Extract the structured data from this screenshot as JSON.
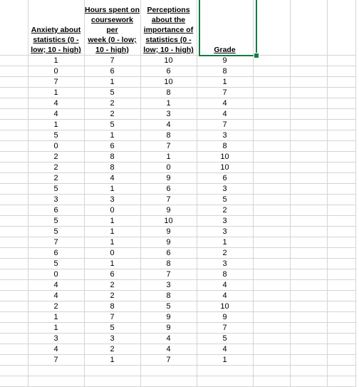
{
  "sheet": {
    "headers": [
      "Anxiety about statistics (0 - low; 10 - high)",
      "Hours spent on coursework per week (0 - low; 10 - high)",
      "Perceptions about the importance of statistics (0 - low; 10 - high)",
      "Grade"
    ],
    "header_lines": [
      [
        "Anxiety about",
        "statistics (0 -",
        "low; 10 - high)"
      ],
      [
        "Hours spent on",
        "coursework per",
        "week (0 - low;",
        "10 - high)"
      ],
      [
        "Perceptions",
        "about the",
        "importance of",
        "statistics (0 -",
        "low; 10 - high)"
      ],
      [
        "Grade"
      ]
    ],
    "selected_cell": "Grade",
    "selection_color": "#107c41",
    "rows": [
      [
        1,
        7,
        10,
        9
      ],
      [
        0,
        6,
        6,
        8
      ],
      [
        7,
        1,
        10,
        1
      ],
      [
        1,
        5,
        8,
        7
      ],
      [
        4,
        2,
        1,
        4
      ],
      [
        4,
        2,
        3,
        4
      ],
      [
        1,
        5,
        4,
        7
      ],
      [
        5,
        1,
        8,
        3
      ],
      [
        0,
        6,
        7,
        8
      ],
      [
        2,
        8,
        1,
        10
      ],
      [
        2,
        8,
        0,
        10
      ],
      [
        2,
        4,
        9,
        6
      ],
      [
        5,
        1,
        6,
        3
      ],
      [
        3,
        3,
        7,
        5
      ],
      [
        6,
        0,
        9,
        2
      ],
      [
        5,
        1,
        10,
        3
      ],
      [
        5,
        1,
        9,
        3
      ],
      [
        7,
        1,
        9,
        1
      ],
      [
        6,
        0,
        6,
        2
      ],
      [
        5,
        1,
        8,
        3
      ],
      [
        0,
        6,
        7,
        8
      ],
      [
        4,
        2,
        3,
        4
      ],
      [
        4,
        2,
        8,
        4
      ],
      [
        2,
        8,
        5,
        10
      ],
      [
        1,
        7,
        9,
        9
      ],
      [
        1,
        5,
        9,
        7
      ],
      [
        3,
        3,
        4,
        5
      ],
      [
        4,
        2,
        4,
        4
      ],
      [
        7,
        1,
        7,
        1
      ]
    ],
    "empty_rows_after": 2
  }
}
